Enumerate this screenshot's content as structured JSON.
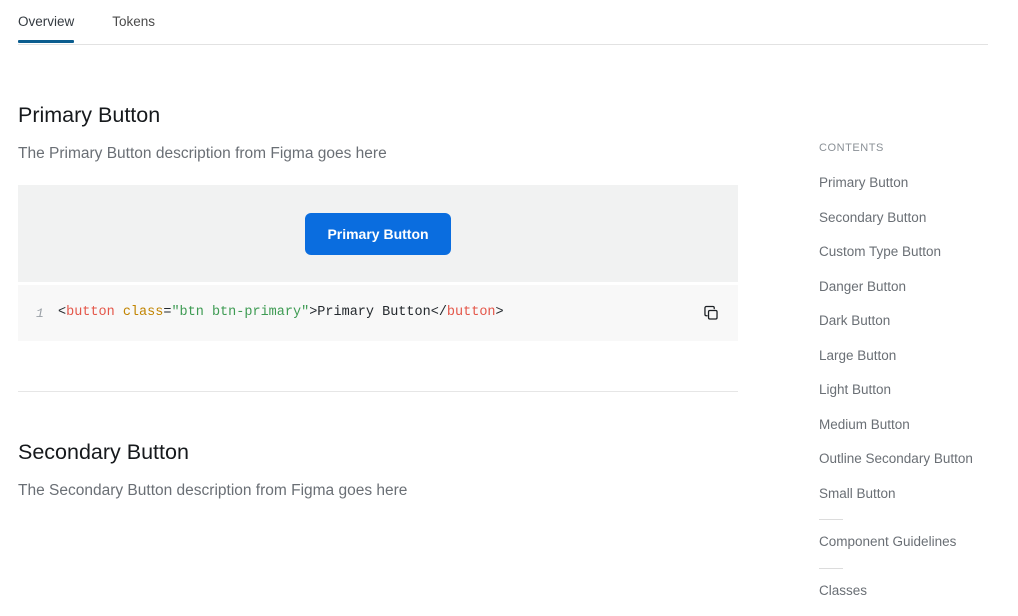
{
  "tabs": [
    {
      "label": "Overview",
      "active": true
    },
    {
      "label": "Tokens",
      "active": false
    }
  ],
  "sections": [
    {
      "title": "Primary Button",
      "description": "The Primary Button description from Figma goes here",
      "preview_button_label": "Primary Button",
      "code": {
        "line_number": "1",
        "punct_open": "<",
        "tag_open": "button",
        "space": " ",
        "attr": "class",
        "equals": "=",
        "value": "\"btn btn-primary\"",
        "punct_gt": ">",
        "text": "Primary Button",
        "punct_close": "</",
        "tag_close": "button",
        "punct_end": ">",
        "full": "<button class=\"btn btn-primary\">Primary Button</button>"
      },
      "copy_icon": "copy-icon"
    },
    {
      "title": "Secondary Button",
      "description": "The Secondary Button description from Figma goes here"
    }
  ],
  "contents": {
    "heading": "CONTENTS",
    "items": [
      {
        "label": "Primary Button",
        "rule_before": false
      },
      {
        "label": "Secondary Button",
        "rule_before": false
      },
      {
        "label": "Custom Type Button",
        "rule_before": false
      },
      {
        "label": "Danger Button",
        "rule_before": false
      },
      {
        "label": "Dark Button",
        "rule_before": false
      },
      {
        "label": "Large Button",
        "rule_before": false
      },
      {
        "label": "Light Button",
        "rule_before": false
      },
      {
        "label": "Medium Button",
        "rule_before": false
      },
      {
        "label": "Outline Secondary Button",
        "rule_before": false
      },
      {
        "label": "Small Button",
        "rule_before": false
      },
      {
        "label": "Component Guidelines",
        "rule_before": true
      },
      {
        "label": "Classes",
        "rule_before": true
      }
    ]
  },
  "colors": {
    "primary_button": "#0a6ddf",
    "tab_underline": "#0b5d8f",
    "preview_bg": "#f1f2f2",
    "code_bg": "#f8f8f8",
    "code_tag": "#e45649",
    "code_attr": "#c18401",
    "code_string": "#3e9b53",
    "muted_text": "#6a6f75"
  }
}
